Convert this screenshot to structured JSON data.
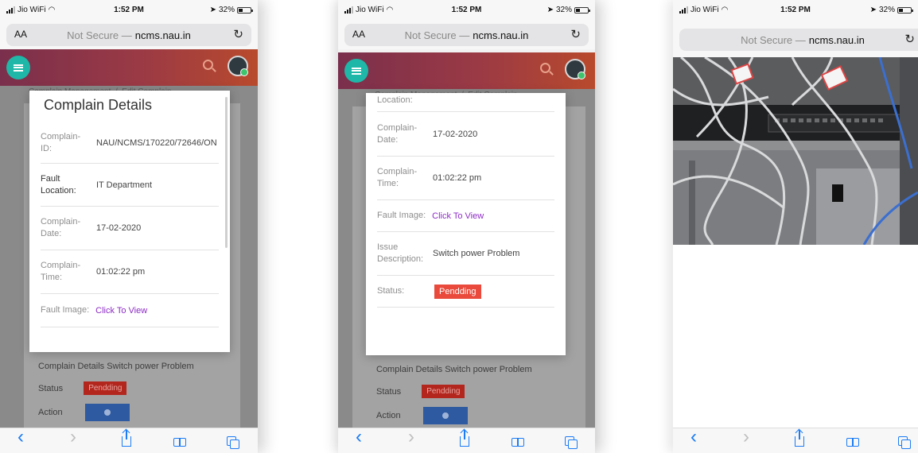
{
  "status": {
    "carrier": "Jio WiFi",
    "time": "1:52 PM",
    "battery": "32%"
  },
  "browser": {
    "aa": "AA",
    "not_secure": "Not Secure —",
    "domain": "ncms.nau.in"
  },
  "background_page": {
    "breadcrumb_1": "Complain Management",
    "breadcrumb_2": "Edit Complain",
    "complain_details_label": "Complain Details",
    "complain_details_value": "Switch power Problem",
    "status_label": "Status",
    "status_value": "Pendding",
    "action_label": "Action"
  },
  "modal": {
    "title": "Complain Details",
    "rows": [
      {
        "label": "Complain-ID:",
        "value": "NAU/NCMS/170220/72646/ON"
      },
      {
        "label": "Fault Location:",
        "value": "IT Department"
      },
      {
        "label": "Complain-Date:",
        "value": "17-02-2020"
      },
      {
        "label": "Complain-Time:",
        "value": "01:02:22 pm"
      },
      {
        "label": "Fault Image:",
        "value": "Click To View"
      },
      {
        "label": "Issue Description:",
        "value": "Switch power Problem"
      },
      {
        "label": "Status:",
        "value": "Pendding"
      }
    ],
    "partial_top_label": "Location:",
    "partial_top_value": "IT Department"
  },
  "toolbar": {
    "back": "‹",
    "forward": "›"
  },
  "colors": {
    "accent_link": "#8d2bc6",
    "status_badge": "#e94a3b",
    "ios_blue": "#1b7cf5",
    "header_start": "#7a2f4c",
    "header_end": "#b84a2c",
    "menu_button": "#1fb7a8"
  }
}
